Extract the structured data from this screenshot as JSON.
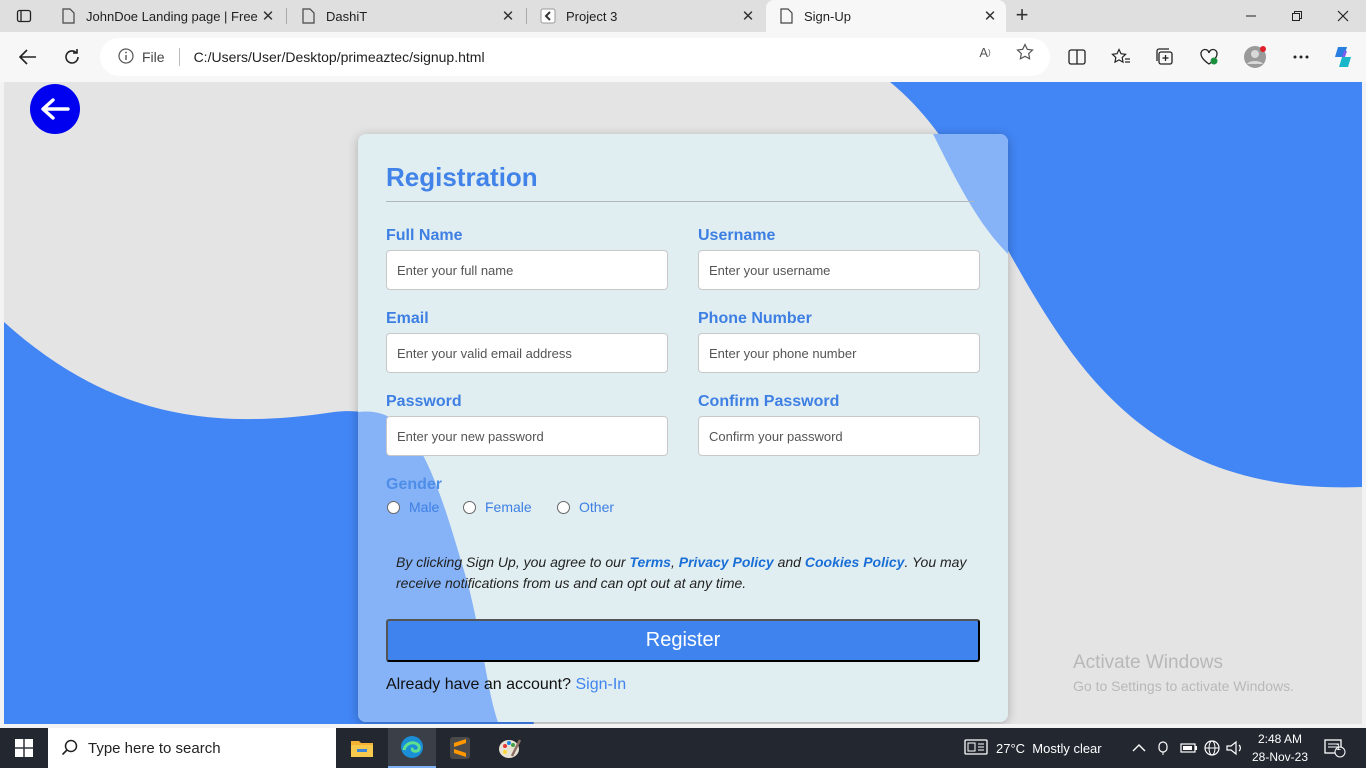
{
  "browser": {
    "tabs": [
      {
        "title": "JohnDoe Landing page | Free Boo",
        "icon": "document-icon"
      },
      {
        "title": "DashiT",
        "icon": "document-icon"
      },
      {
        "title": "Project 3",
        "icon": "project-favicon"
      },
      {
        "title": "Sign-Up",
        "icon": "document-icon",
        "active": true
      }
    ],
    "address": {
      "scheme_label": "File",
      "url": "C:/Users/User/Desktop/primeaztec/signup.html"
    }
  },
  "page": {
    "title": "Registration",
    "fields": {
      "full_name": {
        "label": "Full Name",
        "placeholder": "Enter your full name"
      },
      "username": {
        "label": "Username",
        "placeholder": "Enter your username"
      },
      "email": {
        "label": "Email",
        "placeholder": "Enter your valid email address"
      },
      "phone": {
        "label": "Phone Number",
        "placeholder": "Enter your phone number"
      },
      "password": {
        "label": "Password",
        "placeholder": "Enter your new password"
      },
      "confirm_password": {
        "label": "Confirm Password",
        "placeholder": "Confirm your password"
      }
    },
    "gender": {
      "label": "Gender",
      "options": [
        "Male",
        "Female",
        "Other"
      ]
    },
    "terms": {
      "prefix": "By clicking Sign Up, you agree to our ",
      "terms_link": "Terms",
      "sep1": ", ",
      "privacy_link": "Privacy Policy",
      "sep2": " and ",
      "cookies_link": "Cookies Policy",
      "suffix": ". You may receive notifications from us and can opt out at any time."
    },
    "register_button": "Register",
    "signin": {
      "text": "Already have an account? ",
      "link": "Sign-In"
    },
    "colors": {
      "accent": "#3f84ee",
      "back_button": "#0000f0",
      "wave": "#4285f4"
    }
  },
  "watermark": {
    "line1": "Activate Windows",
    "line2": "Go to Settings to activate Windows."
  },
  "taskbar": {
    "search_placeholder": "Type here to search",
    "weather": "27°C  Mostly clear",
    "time": "2:48 AM",
    "date": "28-Nov-23",
    "notification_count": "1"
  }
}
